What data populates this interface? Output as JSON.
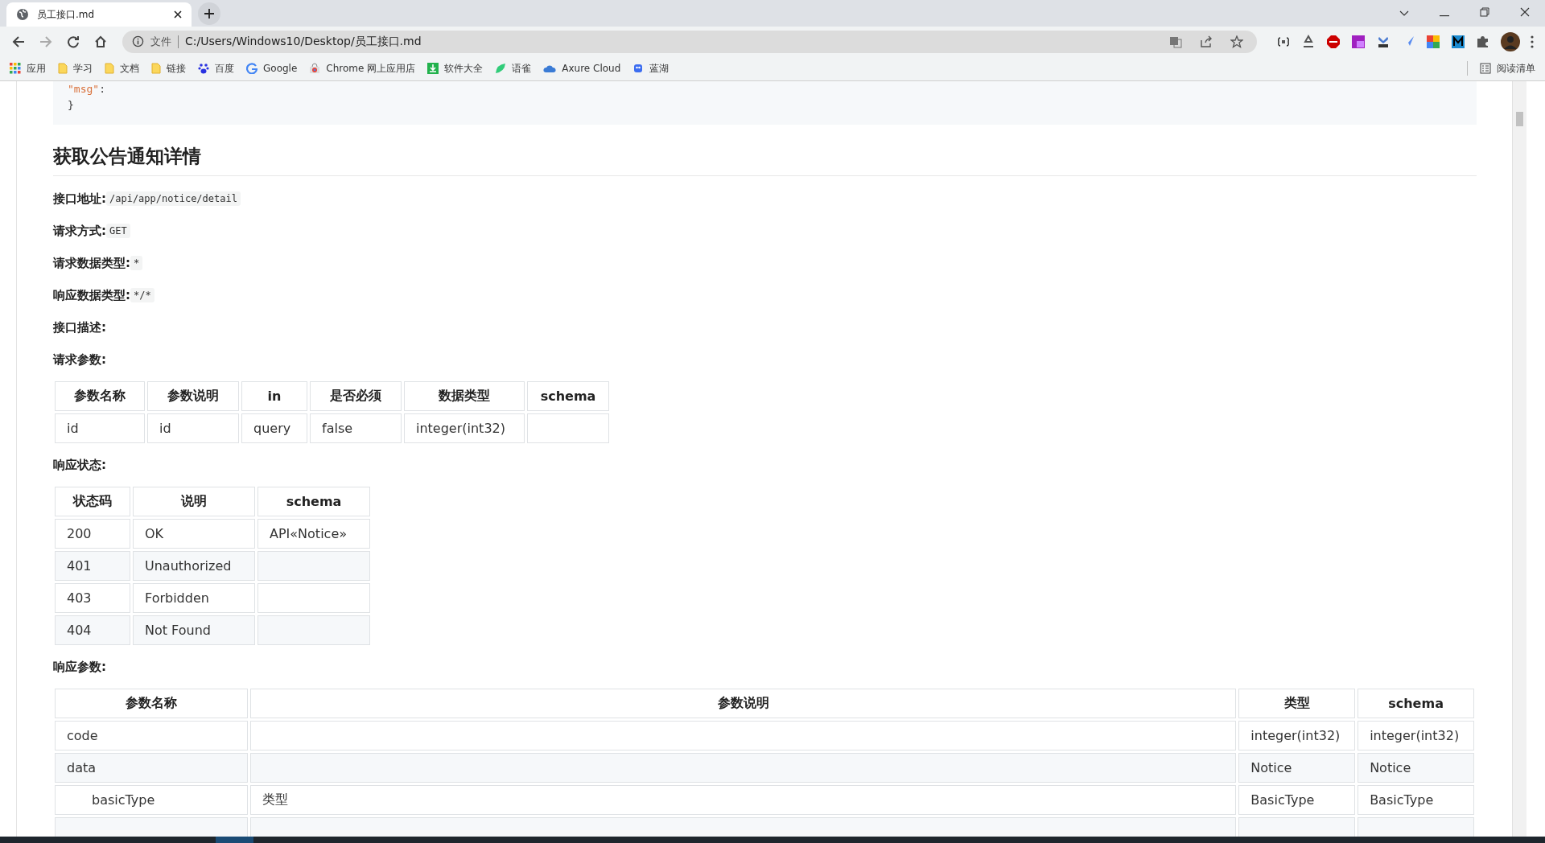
{
  "tab": {
    "title": "员工接口.md"
  },
  "address": {
    "scheme_label": "文件",
    "url": "C:/Users/Windows10/Desktop/员工接口.md"
  },
  "bookmarks": [
    {
      "label": "应用",
      "kind": "apps"
    },
    {
      "label": "学习",
      "kind": "folder"
    },
    {
      "label": "文档",
      "kind": "folder"
    },
    {
      "label": "链接",
      "kind": "folder"
    },
    {
      "label": "百度",
      "kind": "paw"
    },
    {
      "label": "Google",
      "kind": "google"
    },
    {
      "label": "Chrome 网上应用店",
      "kind": "store"
    },
    {
      "label": "软件大全",
      "kind": "download"
    },
    {
      "label": "语雀",
      "kind": "leaf"
    },
    {
      "label": "Axure Cloud",
      "kind": "cloud"
    },
    {
      "label": "蓝湖",
      "kind": "lake"
    }
  ],
  "reading_list": "阅读清单",
  "code_lines": [
    {
      "key": "\"msg\"",
      "rest": ":"
    },
    {
      "rest": "}"
    }
  ],
  "heading": "获取公告通知详情",
  "fields": [
    {
      "label": "接口地址:",
      "code": "/api/app/notice/detail"
    },
    {
      "label": "请求方式:",
      "code": "GET"
    },
    {
      "label": "请求数据类型:",
      "code": "*"
    },
    {
      "label": "响应数据类型:",
      "code": "*/*"
    },
    {
      "label": "接口描述:"
    },
    {
      "label": "请求参数:"
    }
  ],
  "request_table": {
    "columns": [
      "参数名称",
      "参数说明",
      "in",
      "是否必须",
      "数据类型",
      "schema"
    ],
    "rows": [
      [
        "id",
        "id",
        "query",
        "false",
        "integer(int32)",
        ""
      ]
    ]
  },
  "status_label": "响应状态:",
  "status_table": {
    "columns": [
      "状态码",
      "说明",
      "schema"
    ],
    "rows": [
      [
        "200",
        "OK",
        "API«Notice»"
      ],
      [
        "401",
        "Unauthorized",
        ""
      ],
      [
        "403",
        "Forbidden",
        ""
      ],
      [
        "404",
        "Not Found",
        ""
      ]
    ]
  },
  "response_label": "响应参数:",
  "response_table": {
    "columns": [
      "参数名称",
      "参数说明",
      "类型",
      "schema"
    ],
    "rows": [
      {
        "cells": [
          "code",
          "",
          "integer(int32)",
          "integer(int32)"
        ],
        "indented": false
      },
      {
        "cells": [
          "data",
          "",
          "Notice",
          "Notice"
        ],
        "indented": false
      },
      {
        "cells": [
          "basicType",
          "类型",
          "BasicType",
          "BasicType"
        ],
        "indented": true
      },
      {
        "cells": [
          "",
          "",
          "",
          ""
        ],
        "indented": true
      }
    ]
  }
}
